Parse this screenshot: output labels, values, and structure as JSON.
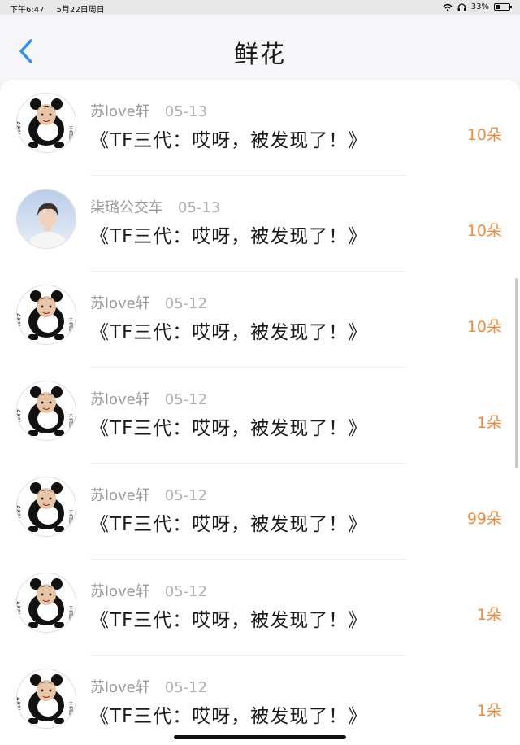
{
  "status_bar": {
    "time": "下午6:47",
    "date": "5月22日周日",
    "battery": "33%"
  },
  "header": {
    "title": "鲜花"
  },
  "rows": [
    {
      "user": "苏love轩",
      "date": "05-13",
      "message": "《TF三代：哎呀，被发现了！》",
      "count": "10朵",
      "avatar_kind": "panda",
      "avatar_text_left": "A敢轩轩",
      "avatar_text_right": "不怕困难"
    },
    {
      "user": "柒璐公交车",
      "date": "05-13",
      "message": "《TF三代：哎呀，被发现了！》",
      "count": "10朵",
      "avatar_kind": "photo"
    },
    {
      "user": "苏love轩",
      "date": "05-12",
      "message": "《TF三代：哎呀，被发现了！》",
      "count": "10朵",
      "avatar_kind": "panda",
      "avatar_text_left": "A敢轩轩",
      "avatar_text_right": "不怕困难"
    },
    {
      "user": "苏love轩",
      "date": "05-12",
      "message": "《TF三代：哎呀，被发现了！》",
      "count": "1朵",
      "avatar_kind": "panda",
      "avatar_text_left": "A敢轩轩",
      "avatar_text_right": "不怕困难"
    },
    {
      "user": "苏love轩",
      "date": "05-12",
      "message": "《TF三代：哎呀，被发现了！》",
      "count": "99朵",
      "avatar_kind": "panda",
      "avatar_text_left": "A敢轩轩",
      "avatar_text_right": "不怕困难"
    },
    {
      "user": "苏love轩",
      "date": "05-12",
      "message": "《TF三代：哎呀，被发现了！》",
      "count": "1朵",
      "avatar_kind": "panda",
      "avatar_text_left": "A敢轩轩",
      "avatar_text_right": "不怕困难"
    },
    {
      "user": "苏love轩",
      "date": "05-12",
      "message": "《TF三代：哎呀，被发现了！》",
      "count": "1朵",
      "avatar_kind": "panda",
      "avatar_text_left": "A敢轩轩",
      "avatar_text_right": "不怕困难"
    }
  ],
  "colors": {
    "accent_blue": "#2e8ff0",
    "count_orange": "#f08a3b"
  },
  "icons": {
    "back": "chevron-left-icon",
    "wifi": "wifi-icon",
    "headphones": "headphones-icon",
    "battery": "battery-icon"
  }
}
